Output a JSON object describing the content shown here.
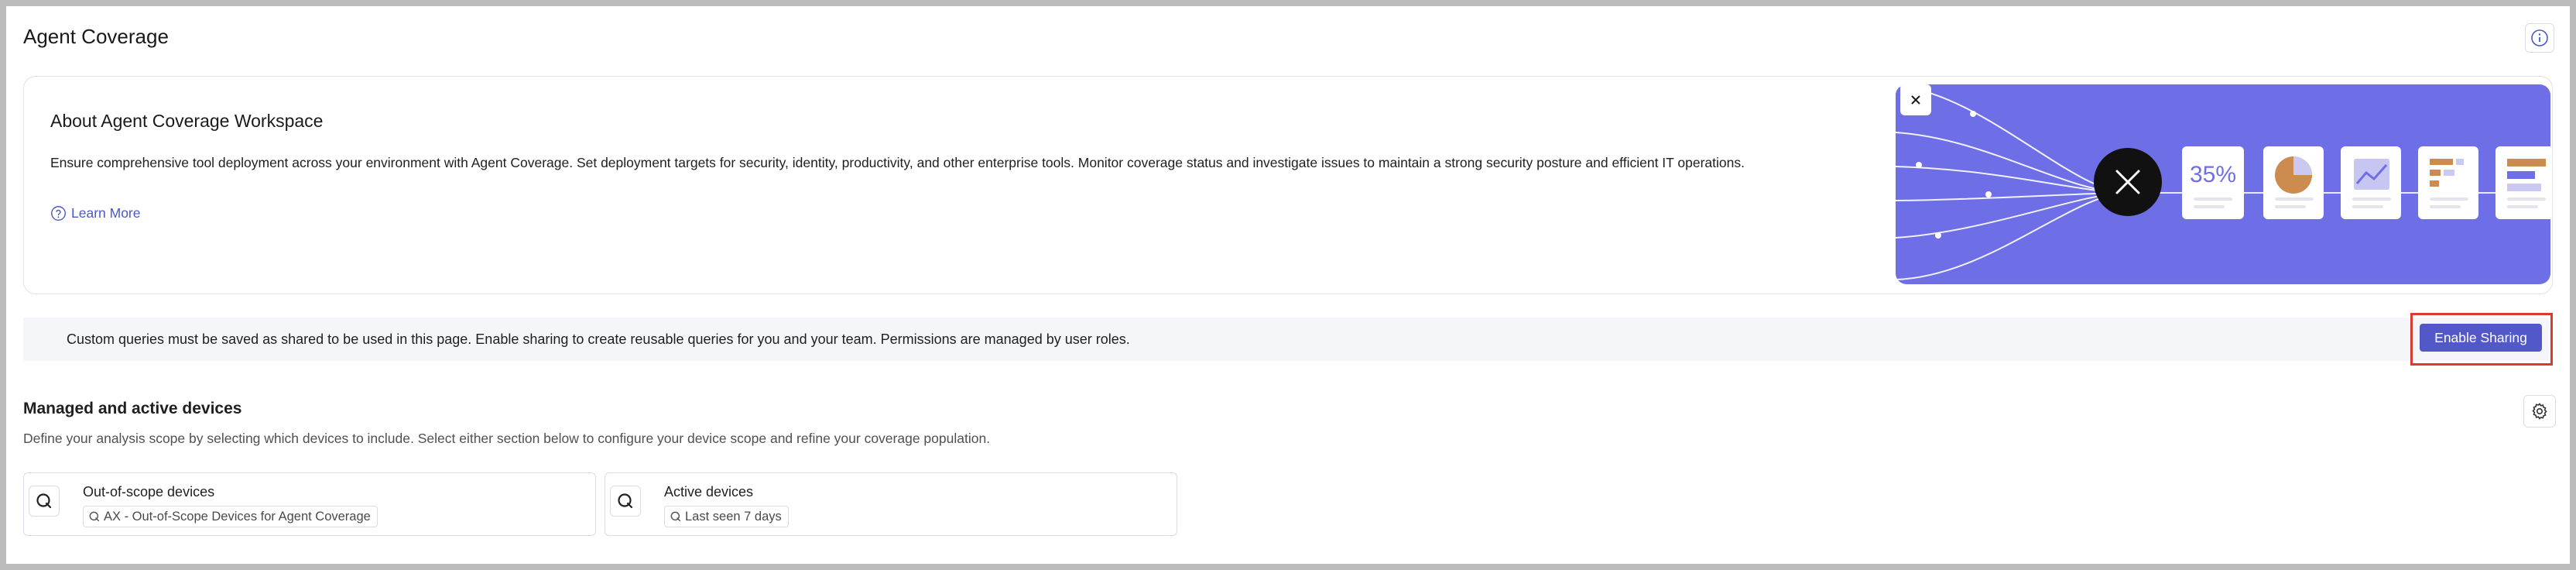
{
  "header": {
    "title": "Agent Coverage",
    "info_icon": "info-icon"
  },
  "about": {
    "title": "About Agent Coverage Workspace",
    "description": "Ensure comprehensive tool deployment across your environment with Agent Coverage. Set deployment targets for security, identity, productivity, and other enterprise tools. Monitor coverage status and investigate issues to maintain a strong security posture and efficient IT operations.",
    "learn_more": "Learn More",
    "banner": {
      "stat_label": "35%",
      "accent_color": "#6e6ee6"
    }
  },
  "notice": {
    "text": "Custom queries must be saved as shared to be used in this page. Enable sharing to create reusable queries for you and your team. Permissions are managed by user roles.",
    "button_label": "Enable Sharing"
  },
  "devices": {
    "title": "Managed and active devices",
    "description": "Define your analysis scope by selecting which devices to include. Select either section below to configure your device scope and refine your coverage population.",
    "cards": [
      {
        "label": "Out-of-scope devices",
        "query": "AX - Out-of-Scope Devices for Agent Coverage"
      },
      {
        "label": "Active devices",
        "query": "Last seen 7 days"
      }
    ]
  },
  "colors": {
    "primary_button": "#5358c8",
    "link": "#4b57c7",
    "highlight": "#dd3a2e"
  }
}
